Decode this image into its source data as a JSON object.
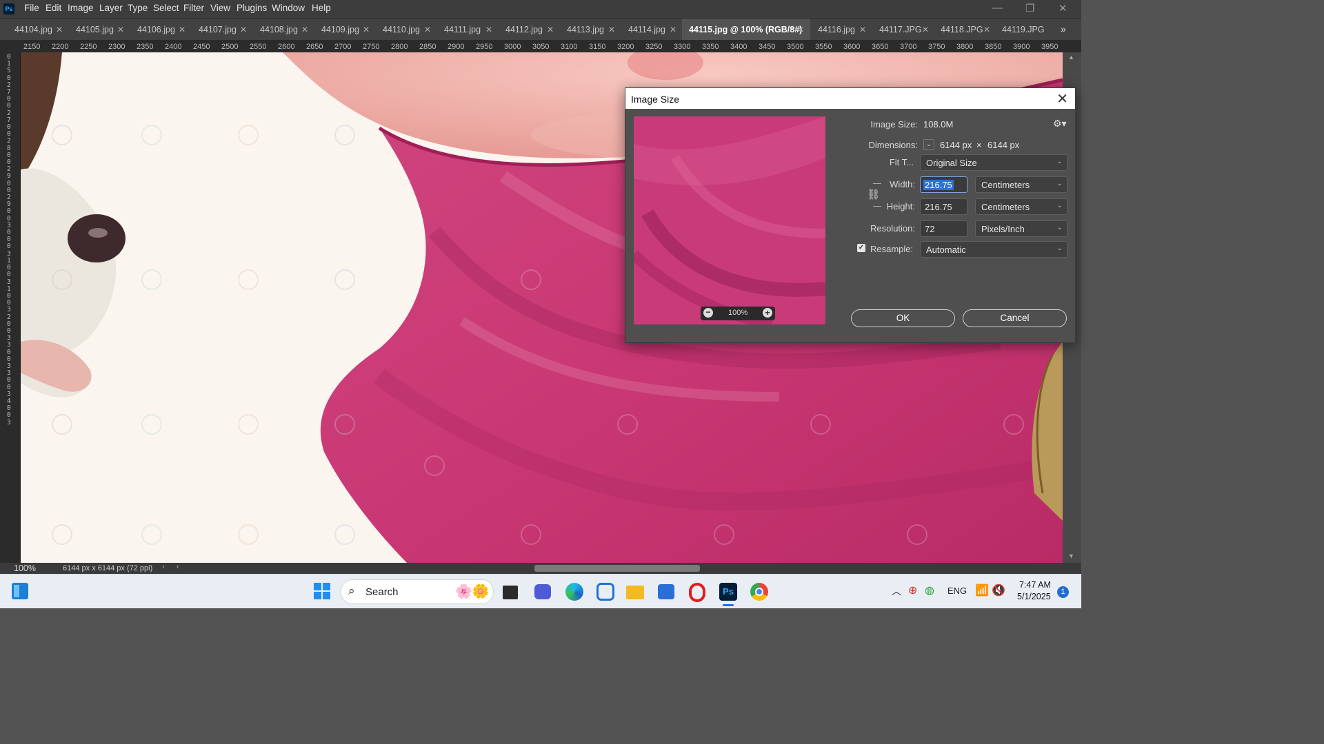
{
  "app": {
    "logo_text": "Ps"
  },
  "menu": [
    "File",
    "Edit",
    "Image",
    "Layer",
    "Type",
    "Select",
    "Filter",
    "View",
    "Plugins",
    "Window",
    "Help"
  ],
  "tabs": [
    {
      "label": "44104.jpg",
      "active": false
    },
    {
      "label": "44105.jpg",
      "active": false
    },
    {
      "label": "44106.jpg",
      "active": false
    },
    {
      "label": "44107.jpg",
      "active": false
    },
    {
      "label": "44108.jpg",
      "active": false
    },
    {
      "label": "44109.jpg",
      "active": false
    },
    {
      "label": "44110.jpg",
      "active": false
    },
    {
      "label": "44111.jpg",
      "active": false
    },
    {
      "label": "44112.jpg",
      "active": false
    },
    {
      "label": "44113.jpg",
      "active": false
    },
    {
      "label": "44114.jpg",
      "active": false
    },
    {
      "label": "44115.jpg @ 100% (RGB/8#)",
      "active": true
    },
    {
      "label": "44116.jpg",
      "active": false
    },
    {
      "label": "44117.JPG",
      "active": false
    },
    {
      "label": "44118.JPG",
      "active": false
    },
    {
      "label": "44119.JPG",
      "active": false
    }
  ],
  "ruler_top": [
    "2150",
    "2200",
    "2250",
    "2300",
    "2350",
    "2400",
    "2450",
    "2500",
    "2550",
    "2600",
    "2650",
    "2700",
    "2750",
    "2800",
    "2850",
    "2900",
    "2950",
    "3000",
    "3050",
    "3100",
    "3150",
    "3200",
    "3250",
    "3300",
    "3350",
    "3400",
    "3450",
    "3500",
    "3550",
    "3600",
    "3650",
    "3700",
    "3750",
    "3800",
    "3850",
    "3900",
    "3950"
  ],
  "ruler_left_digits": "01502700270028002900290030003100310032003300330034003",
  "status": {
    "zoom": "100%",
    "doc_info": "6144 px x 6144 px (72 ppi)"
  },
  "dialog": {
    "title": "Image Size",
    "image_size_label": "Image Size:",
    "image_size_value": "108.0M",
    "dimensions_label": "Dimensions:",
    "dim_width": "6144 px",
    "dim_x": "×",
    "dim_height": "6144 px",
    "fit_label": "Fit T...",
    "fit_value": "Original Size",
    "width_label": "Width:",
    "width_value": "216.75",
    "width_unit": "Centimeters",
    "height_label": "Height:",
    "height_value": "216.75",
    "height_unit": "Centimeters",
    "resolution_label": "Resolution:",
    "resolution_value": "72",
    "resolution_unit": "Pixels/Inch",
    "resample_label": "Resample:",
    "resample_checked": true,
    "resample_value": "Automatic",
    "preview_zoom": "100%",
    "ok_label": "OK",
    "cancel_label": "Cancel"
  },
  "taskbar": {
    "search_label": "Search",
    "language": "ENG",
    "time": "7:47 AM",
    "date": "5/1/2025",
    "notification_count": "1"
  }
}
